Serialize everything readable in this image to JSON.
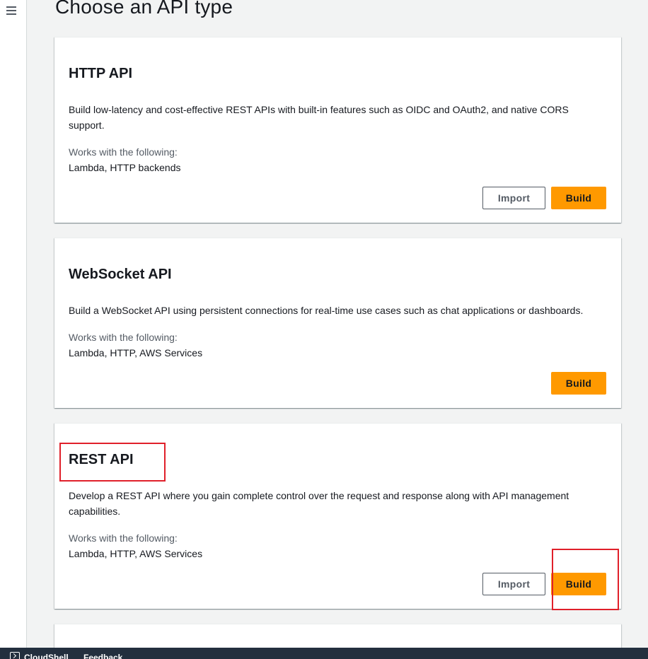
{
  "page": {
    "title": "Choose an API type"
  },
  "cards": [
    {
      "title": "HTTP API",
      "description": "Build low-latency and cost-effective REST APIs with built-in features such as OIDC and OAuth2, and native CORS support.",
      "works_label": "Works with the following:",
      "works_value": "Lambda, HTTP backends",
      "import_label": "Import",
      "build_label": "Build"
    },
    {
      "title": "WebSocket API",
      "description": "Build a WebSocket API using persistent connections for real-time use cases such as chat applications or dashboards.",
      "works_label": "Works with the following:",
      "works_value": "Lambda, HTTP, AWS Services",
      "build_label": "Build"
    },
    {
      "title": "REST API",
      "description": "Develop a REST API where you gain complete control over the request and response along with API management capabilities.",
      "works_label": "Works with the following:",
      "works_value": "Lambda, HTTP, AWS Services",
      "import_label": "Import",
      "build_label": "Build"
    }
  ],
  "footer": {
    "cloudshell_label": "CloudShell",
    "feedback_label": "Feedback"
  },
  "icons": {
    "menu": "hamburger-menu-icon",
    "cloudshell": "cloudshell-icon"
  },
  "colors": {
    "primary_button": "#ff9900",
    "highlight": "#e0202a",
    "footer_bg": "#232f3e"
  }
}
